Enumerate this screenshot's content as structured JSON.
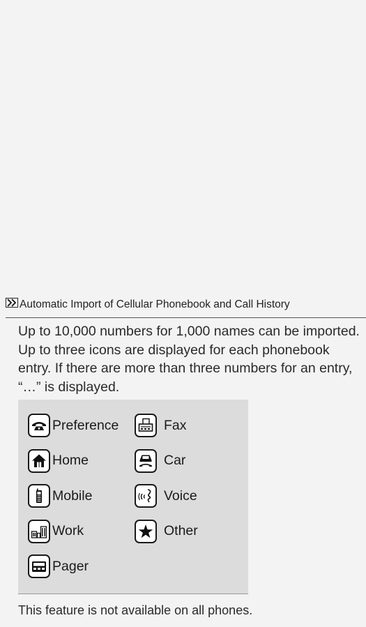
{
  "header": {
    "title": "Automatic Import of Cellular Phonebook and Call History"
  },
  "body": {
    "paragraph": "Up to 10,000 numbers for 1,000 names can be imported. Up to three icons are displayed for each phonebook entry. If there are more than three numbers for an entry, “…” is displayed."
  },
  "icons": {
    "preference": {
      "label": "Preference",
      "icon": "telephone-icon"
    },
    "fax": {
      "label": "Fax",
      "icon": "fax-icon"
    },
    "home": {
      "label": "Home",
      "icon": "house-icon"
    },
    "car": {
      "label": "Car",
      "icon": "car-phone-icon"
    },
    "mobile": {
      "label": "Mobile",
      "icon": "mobile-phone-icon"
    },
    "voice": {
      "label": "Voice",
      "icon": "voice-icon"
    },
    "work": {
      "label": "Work",
      "icon": "office-building-icon"
    },
    "other": {
      "label": "Other",
      "icon": "star-icon"
    },
    "pager": {
      "label": "Pager",
      "icon": "pager-icon"
    }
  },
  "footer": {
    "note": "This feature is not available on all phones."
  }
}
